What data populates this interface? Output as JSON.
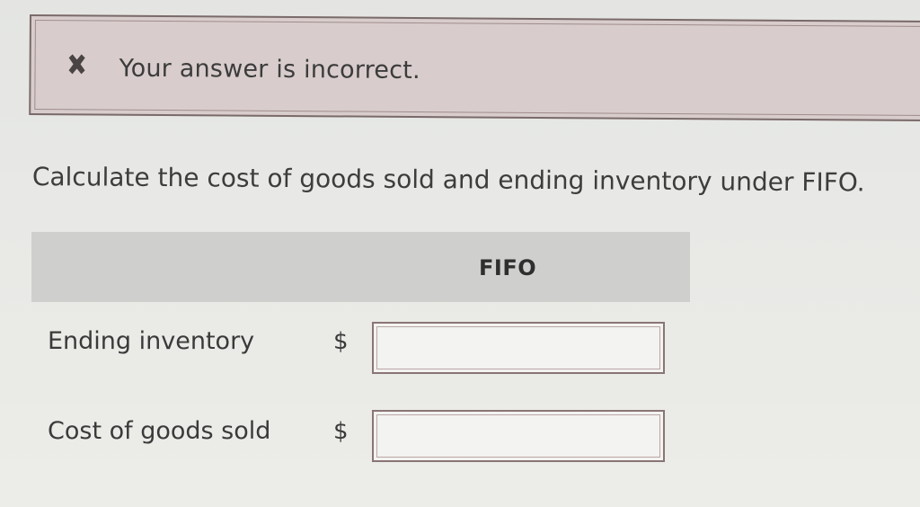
{
  "alert": {
    "icon": "close-icon",
    "message": "Your answer is incorrect.",
    "status_color": "#d8cdcc"
  },
  "question": {
    "prompt": "Calculate the cost of goods sold and ending inventory under FIFO."
  },
  "table": {
    "column_header": "FIFO",
    "rows": [
      {
        "label": "Ending inventory",
        "currency": "$",
        "value": ""
      },
      {
        "label": "Cost of goods sold",
        "currency": "$",
        "value": ""
      }
    ]
  }
}
